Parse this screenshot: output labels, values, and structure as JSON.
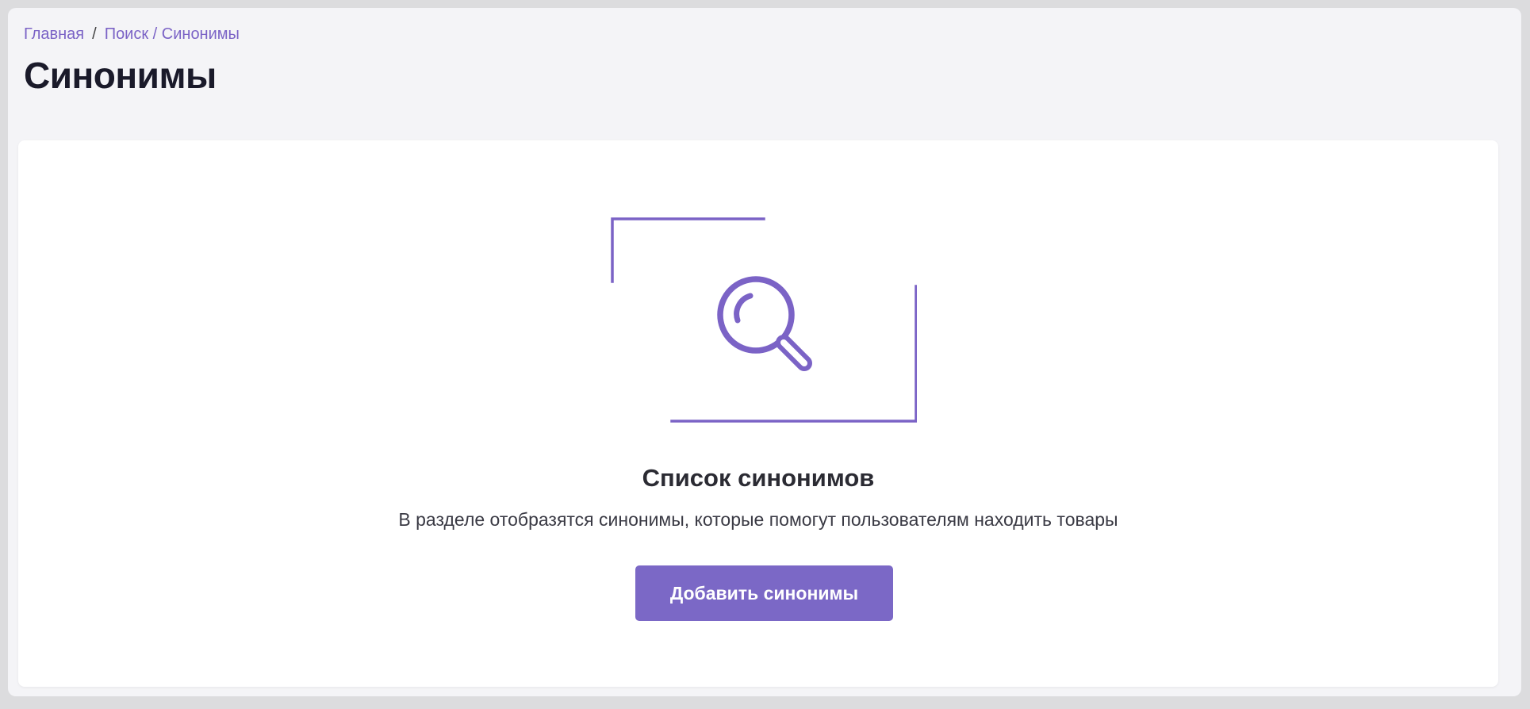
{
  "breadcrumb": {
    "home": "Главная",
    "separator": "/",
    "current": "Поиск / Синонимы"
  },
  "page": {
    "title": "Синонимы"
  },
  "empty_state": {
    "icon": "search-icon",
    "title": "Список синонимов",
    "description": "В разделе отобразятся синонимы, которые помогут пользователям находить товары",
    "button_label": "Добавить синонимы"
  },
  "colors": {
    "accent": "#7b68c6",
    "link": "#7b63c6",
    "title": "#1a1a2a",
    "background": "#f4f4f7",
    "card": "#ffffff"
  }
}
